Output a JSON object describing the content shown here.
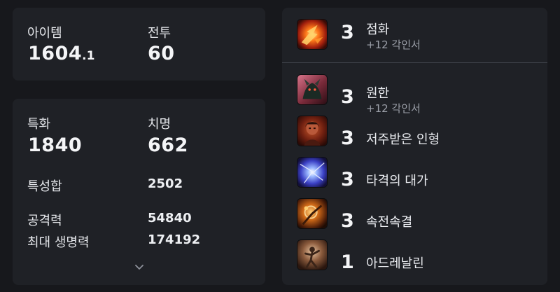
{
  "summary": {
    "item_level_label": "아이템",
    "item_level_main": "1604",
    "item_level_decimal": ".1",
    "combat_label": "전투",
    "combat_value": "60"
  },
  "stats": {
    "specialization_label": "특화",
    "specialization_value": "1840",
    "crit_label": "치명",
    "crit_value": "662",
    "stat_total_label": "특성합",
    "stat_total_value": "2502",
    "attack_label": "공격력",
    "attack_value": "54840",
    "max_hp_label": "최대 생명력",
    "max_hp_value": "174192",
    "expand_icon": "chevron-down-icon"
  },
  "engravings": [
    {
      "level": "3",
      "name": "점화",
      "sub": "+12 각인서",
      "icon": "ignition-icon"
    },
    {
      "level": "3",
      "name": "원한",
      "sub": "+12 각인서",
      "icon": "grudge-icon"
    },
    {
      "level": "3",
      "name": "저주받은 인형",
      "sub": "",
      "icon": "cursed-doll-icon"
    },
    {
      "level": "3",
      "name": "타격의 대가",
      "sub": "",
      "icon": "hit-master-icon"
    },
    {
      "level": "3",
      "name": "속전속결",
      "sub": "",
      "icon": "all-out-attack-icon"
    },
    {
      "level": "1",
      "name": "아드레날린",
      "sub": "",
      "icon": "adrenaline-icon"
    }
  ],
  "colors": {
    "background": "#17181c",
    "card": "#1f2126",
    "text_primary": "#eceef2",
    "text_secondary": "#9b9fa8",
    "divider": "#3e4149"
  }
}
